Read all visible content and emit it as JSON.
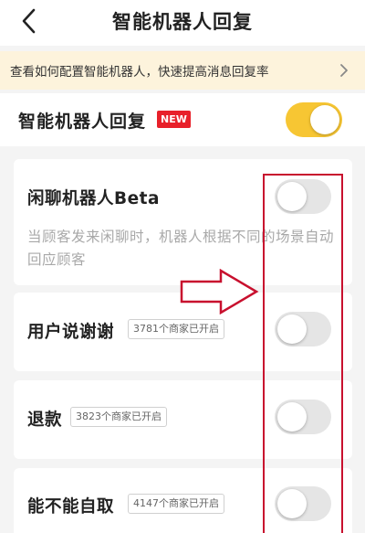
{
  "header": {
    "title": "智能机器人回复",
    "back_icon": "chevron-left-icon"
  },
  "banner": {
    "text": "查看如何配置智能机器人，快速提高消息回复率",
    "arrow_icon": "chevron-right-icon"
  },
  "master": {
    "label": "智能机器人回复",
    "badge": "NEW",
    "toggle_on": true,
    "accent": "#f7c633"
  },
  "features": [
    {
      "title": "闲聊机器人Beta",
      "description": "当顾客发来闲聊时，机器人根据不同的场景自动回应顾客",
      "toggle_on": false
    },
    {
      "title": "用户说谢谢",
      "badge": "3781个商家已开启",
      "toggle_on": false
    },
    {
      "title": "退款",
      "badge": "3823个商家已开启",
      "toggle_on": false
    },
    {
      "title": "能不能自取",
      "badge": "4147个商家已开启",
      "toggle_on": false
    }
  ],
  "annotation": {
    "color": "#c8102e",
    "arrow_icon": "right-arrow-icon"
  }
}
